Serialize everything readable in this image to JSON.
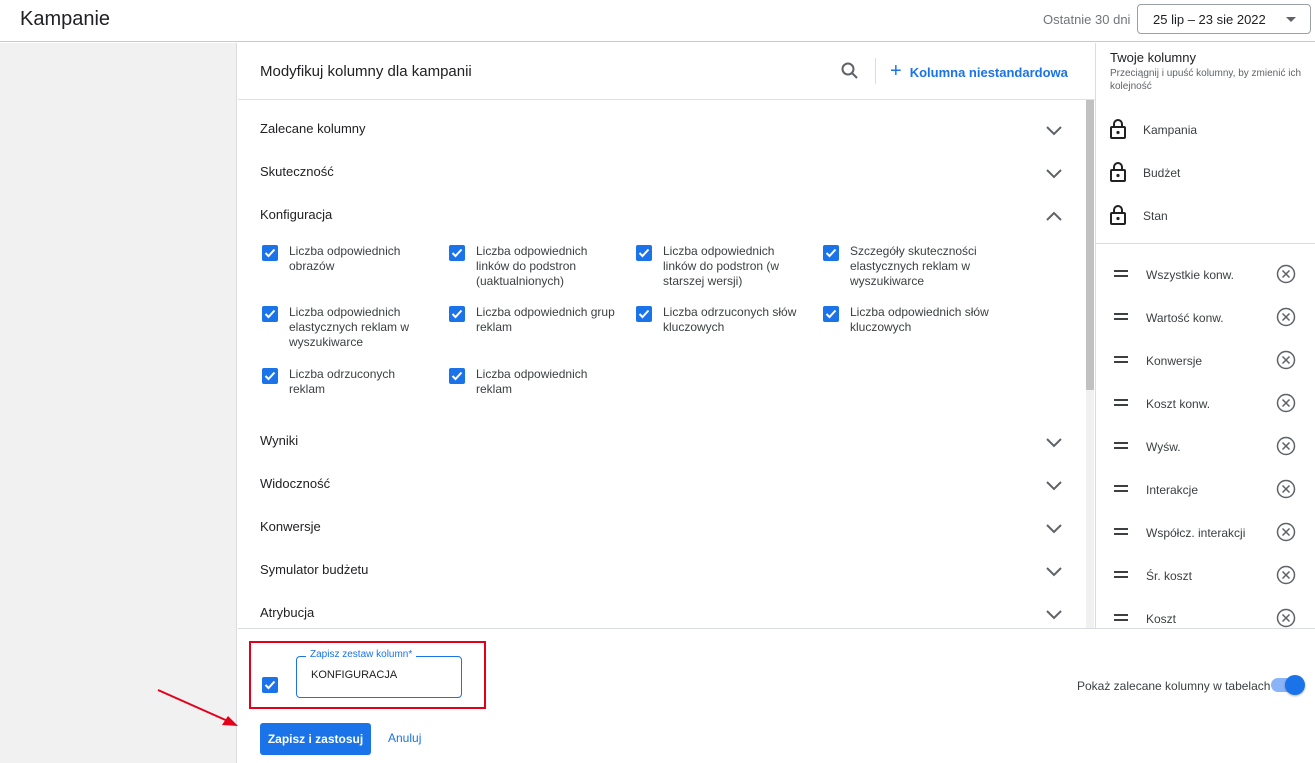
{
  "topbar": {
    "title": "Kampanie",
    "date_range_label": "Ostatnie 30 dni",
    "date_range_value": "25 lip – 23 sie 2022"
  },
  "panel": {
    "title": "Modyfikuj kolumny dla kampanii",
    "search_icon": "search-icon",
    "custom_column_label": "Kolumna niestandardowa",
    "sections": [
      {
        "label": "Zalecane kolumny",
        "expanded": false
      },
      {
        "label": "Skuteczność",
        "expanded": false
      },
      {
        "label": "Konfiguracja",
        "expanded": true
      },
      {
        "label": "Wyniki",
        "expanded": false
      },
      {
        "label": "Widoczność",
        "expanded": false
      },
      {
        "label": "Konwersje",
        "expanded": false
      },
      {
        "label": "Symulator budżetu",
        "expanded": false
      },
      {
        "label": "Atrybucja",
        "expanded": false
      }
    ],
    "config_checkboxes": [
      {
        "label": "Liczba odpowiednich obrazów",
        "checked": true
      },
      {
        "label": "Liczba odpowiednich linków do podstron (uaktualnionych)",
        "checked": true
      },
      {
        "label": "Liczba odpowiednich linków do podstron (w starszej wersji)",
        "checked": true
      },
      {
        "label": "Szczegóły skuteczności elastycznych reklam w wyszukiwarce",
        "checked": true
      },
      {
        "label": "Liczba odpowiednich elastycznych reklam w wyszukiwarce",
        "checked": true
      },
      {
        "label": "Liczba odpowiednich grup reklam",
        "checked": true
      },
      {
        "label": "Liczba odrzuconych słów kluczowych",
        "checked": true
      },
      {
        "label": "Liczba odpowiednich słów kluczowych",
        "checked": true
      },
      {
        "label": "Liczba odrzuconych reklam",
        "checked": true
      },
      {
        "label": "Liczba odpowiednich reklam",
        "checked": true
      }
    ]
  },
  "your_columns": {
    "title": "Twoje kolumny",
    "subtitle": "Przeciągnij i upuść kolumny, by zmienić ich kolejność",
    "locked": [
      "Kampania",
      "Budżet",
      "Stan"
    ],
    "selected": [
      "Wszystkie konw.",
      "Wartość konw.",
      "Konwersje",
      "Koszt konw.",
      "Wyśw.",
      "Interakcje",
      "Współcz. interakcji",
      "Śr. koszt",
      "Koszt"
    ]
  },
  "footer": {
    "save_set_checked": true,
    "field_label": "Zapisz zestaw kolumn*",
    "field_value": "KONFIGURACJA",
    "show_recommended_label": "Pokaż zalecane kolumny w tabelach",
    "show_recommended_on": true,
    "save_button": "Zapisz i zastosuj",
    "cancel_button": "Anuluj"
  },
  "colors": {
    "accent": "#1a73e8",
    "highlight": "#e3001b"
  }
}
